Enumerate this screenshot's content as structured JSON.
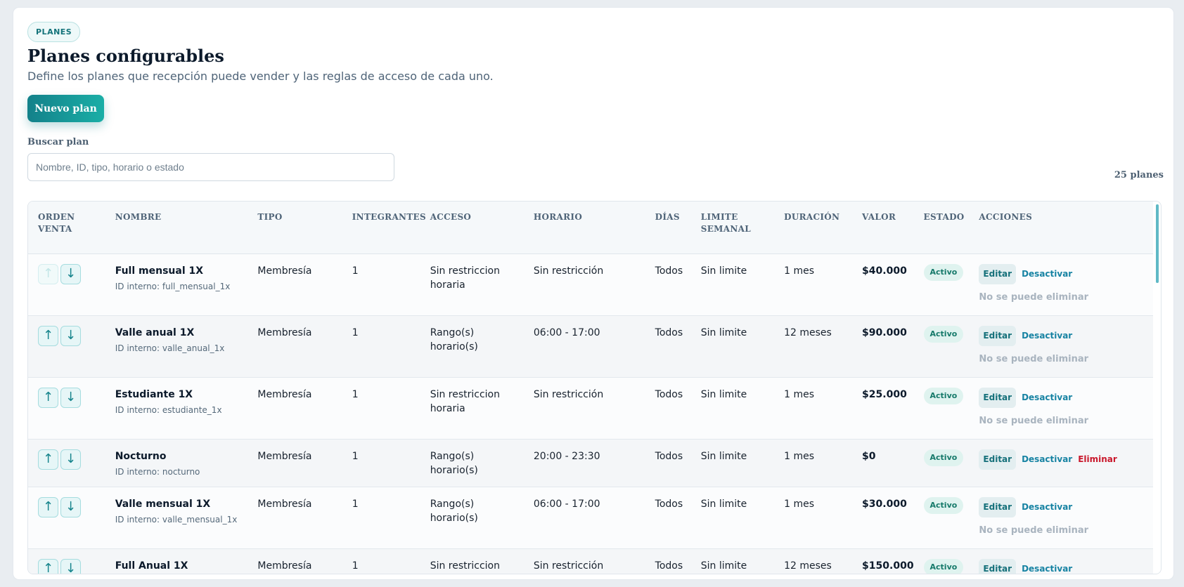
{
  "badge": "PLANES",
  "title": "Planes configurables",
  "subtitle": "Define los planes que recepción puede vender y las reglas de acceso de cada uno.",
  "new_button": "Nuevo plan",
  "search": {
    "label": "Buscar plan",
    "placeholder": "Nombre, ID, tipo, horario o estado",
    "value": ""
  },
  "count": "25 planes",
  "columns": {
    "orden": "ORDEN VENTA",
    "nombre": "NOMBRE",
    "tipo": "TIPO",
    "integrantes": "INTEGRANTES",
    "acceso": "ACCESO",
    "horario": "HORARIO",
    "dias": "DÍAS",
    "limite": "LIMITE SEMANAL",
    "duracion": "DURACIÓN",
    "valor": "VALOR",
    "estado": "ESTADO",
    "acciones": "ACCIONES"
  },
  "icons": {
    "up": "arrow-up-icon",
    "down": "arrow-down-icon"
  },
  "glyphs": {
    "up": "↑",
    "down": "↓"
  },
  "actions": {
    "edit": "Editar",
    "deactivate": "Desactivar",
    "delete": "Eliminar",
    "no_delete": "No se puede eliminar"
  },
  "colors": {
    "accent": "#13818a",
    "status_bg": "#dff3ef",
    "delete": "#c9172b"
  },
  "rows": [
    {
      "name": "Full mensual 1X",
      "id": "ID interno: full_mensual_1x",
      "tipo": "Membresía",
      "integrantes": "1",
      "acceso": "Sin restriccion horaria",
      "horario": "Sin restricción",
      "dias": "Todos",
      "limite": "Sin limite",
      "duracion": "1 mes",
      "valor": "$40.000",
      "estado": "Activo"
    },
    {
      "name": "Valle anual 1X",
      "id": "ID interno: valle_anual_1x",
      "tipo": "Membresía",
      "integrantes": "1",
      "acceso": "Rango(s) horario(s)",
      "horario": "06:00 - 17:00",
      "dias": "Todos",
      "limite": "Sin limite",
      "duracion": "12 meses",
      "valor": "$90.000",
      "estado": "Activo"
    },
    {
      "name": "Estudiante 1X",
      "id": "ID interno: estudiante_1x",
      "tipo": "Membresía",
      "integrantes": "1",
      "acceso": "Sin restriccion horaria",
      "horario": "Sin restricción",
      "dias": "Todos",
      "limite": "Sin limite",
      "duracion": "1 mes",
      "valor": "$25.000",
      "estado": "Activo"
    },
    {
      "name": "Nocturno",
      "id": "ID interno: nocturno",
      "tipo": "Membresía",
      "integrantes": "1",
      "acceso": "Rango(s) horario(s)",
      "horario": "20:00 - 23:30",
      "dias": "Todos",
      "limite": "Sin limite",
      "duracion": "1 mes",
      "valor": "$0",
      "estado": "Activo"
    },
    {
      "name": "Valle mensual 1X",
      "id": "ID interno: valle_mensual_1x",
      "tipo": "Membresía",
      "integrantes": "1",
      "acceso": "Rango(s) horario(s)",
      "horario": "06:00 - 17:00",
      "dias": "Todos",
      "limite": "Sin limite",
      "duracion": "1 mes",
      "valor": "$30.000",
      "estado": "Activo"
    },
    {
      "name": "Full Anual 1X",
      "id": "",
      "tipo": "Membresía",
      "integrantes": "1",
      "acceso": "Sin restriccion horaria",
      "horario": "Sin restricción",
      "dias": "Todos",
      "limite": "Sin limite",
      "duracion": "12 meses",
      "valor": "$150.000",
      "estado": "Activo"
    }
  ]
}
